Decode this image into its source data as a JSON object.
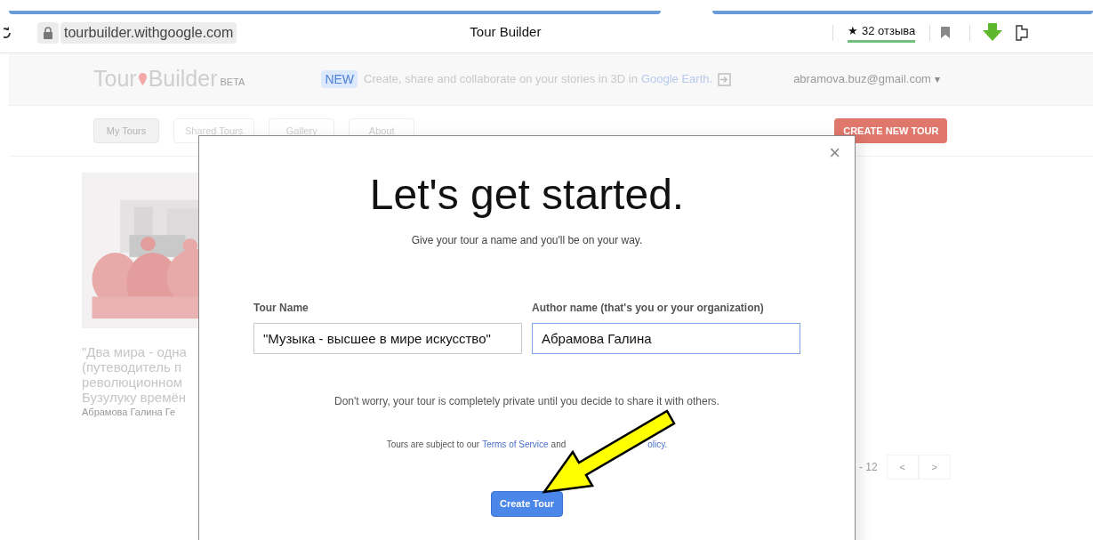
{
  "browser": {
    "url": "tourbuilder.withgoogle.com",
    "tab_title": "Tour Builder",
    "reviews_star": "★",
    "reviews": "32 отзыва"
  },
  "header": {
    "logo_word_1": "Tour",
    "logo_word_2": "Builder",
    "logo_badge": "BETA",
    "announcement_badge": "NEW",
    "announcement": "Create, share and collaborate on your stories in 3D in",
    "announcement_link": "Google Earth.",
    "account": "abramova.buz@gmail.com",
    "account_caret": "▾"
  },
  "nav_tabs": [
    {
      "label": "My Tours",
      "selected": true
    },
    {
      "label": "Shared Tours",
      "selected": false
    },
    {
      "label": "Gallery",
      "selected": false
    },
    {
      "label": "About",
      "selected": false
    }
  ],
  "create_new_button": "CREATE NEW TOUR",
  "tour_card": {
    "title_lines": [
      "\"Два мира - одна",
      "(путеводитель п",
      "революционном",
      "Бузулуку времён"
    ],
    "author": "Абрамова Галина Ге"
  },
  "pagination": {
    "range": "- 12",
    "prev": "<",
    "next": ">"
  },
  "dialog": {
    "close": "×",
    "heading": "Let's get started.",
    "subheading": "Give your tour a name and you'll be on your way.",
    "fields": [
      {
        "label": "Tour Name",
        "value": "\"Музыка - высшее в мире искусство\"",
        "focused": false
      },
      {
        "label": "Author name (that's you or your organization)",
        "value": "Абрамова Галина",
        "focused": true
      }
    ],
    "note": "Don't worry, your tour is completely private until you decide to share it with others.",
    "terms_text": "Tours are subject to our",
    "terms_link": "Terms of Service",
    "terms_and": "and",
    "policy_link_tail": "olicy.",
    "submit": "Create Tour"
  }
}
